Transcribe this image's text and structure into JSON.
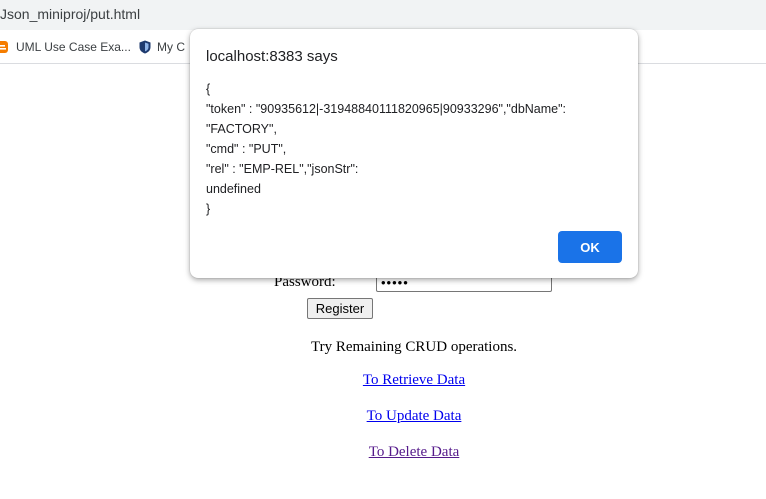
{
  "browser": {
    "url": "Json_miniproj/put.html",
    "bookmarks": [
      {
        "label": "UML Use Case Exa...",
        "icon": "blogger-icon"
      },
      {
        "label": "My C",
        "icon": "shield-icon"
      }
    ]
  },
  "form": {
    "password_label": "Password:",
    "password_value": "•••••",
    "register_label": "Register"
  },
  "content": {
    "try_text": "Try Remaining CRUD operations.",
    "links": [
      {
        "label": "To Retrieve Data"
      },
      {
        "label": "To Update Data"
      },
      {
        "label": "To Delete Data"
      }
    ]
  },
  "dialog": {
    "title": "localhost:8383 says",
    "lines": [
      "{",
      "\"token\" : \"90935612|-31948840111820965|90933296\",\"dbName\":",
      "\"FACTORY\",",
      "\"cmd\" : \"PUT\",",
      "\"rel\" : \"EMP-REL\",\"jsonStr\":",
      "undefined",
      "}"
    ],
    "ok_label": "OK"
  },
  "colors": {
    "ok_button": "#1a73e8",
    "link": "#0000ee",
    "visited_link": "#551a8b"
  }
}
